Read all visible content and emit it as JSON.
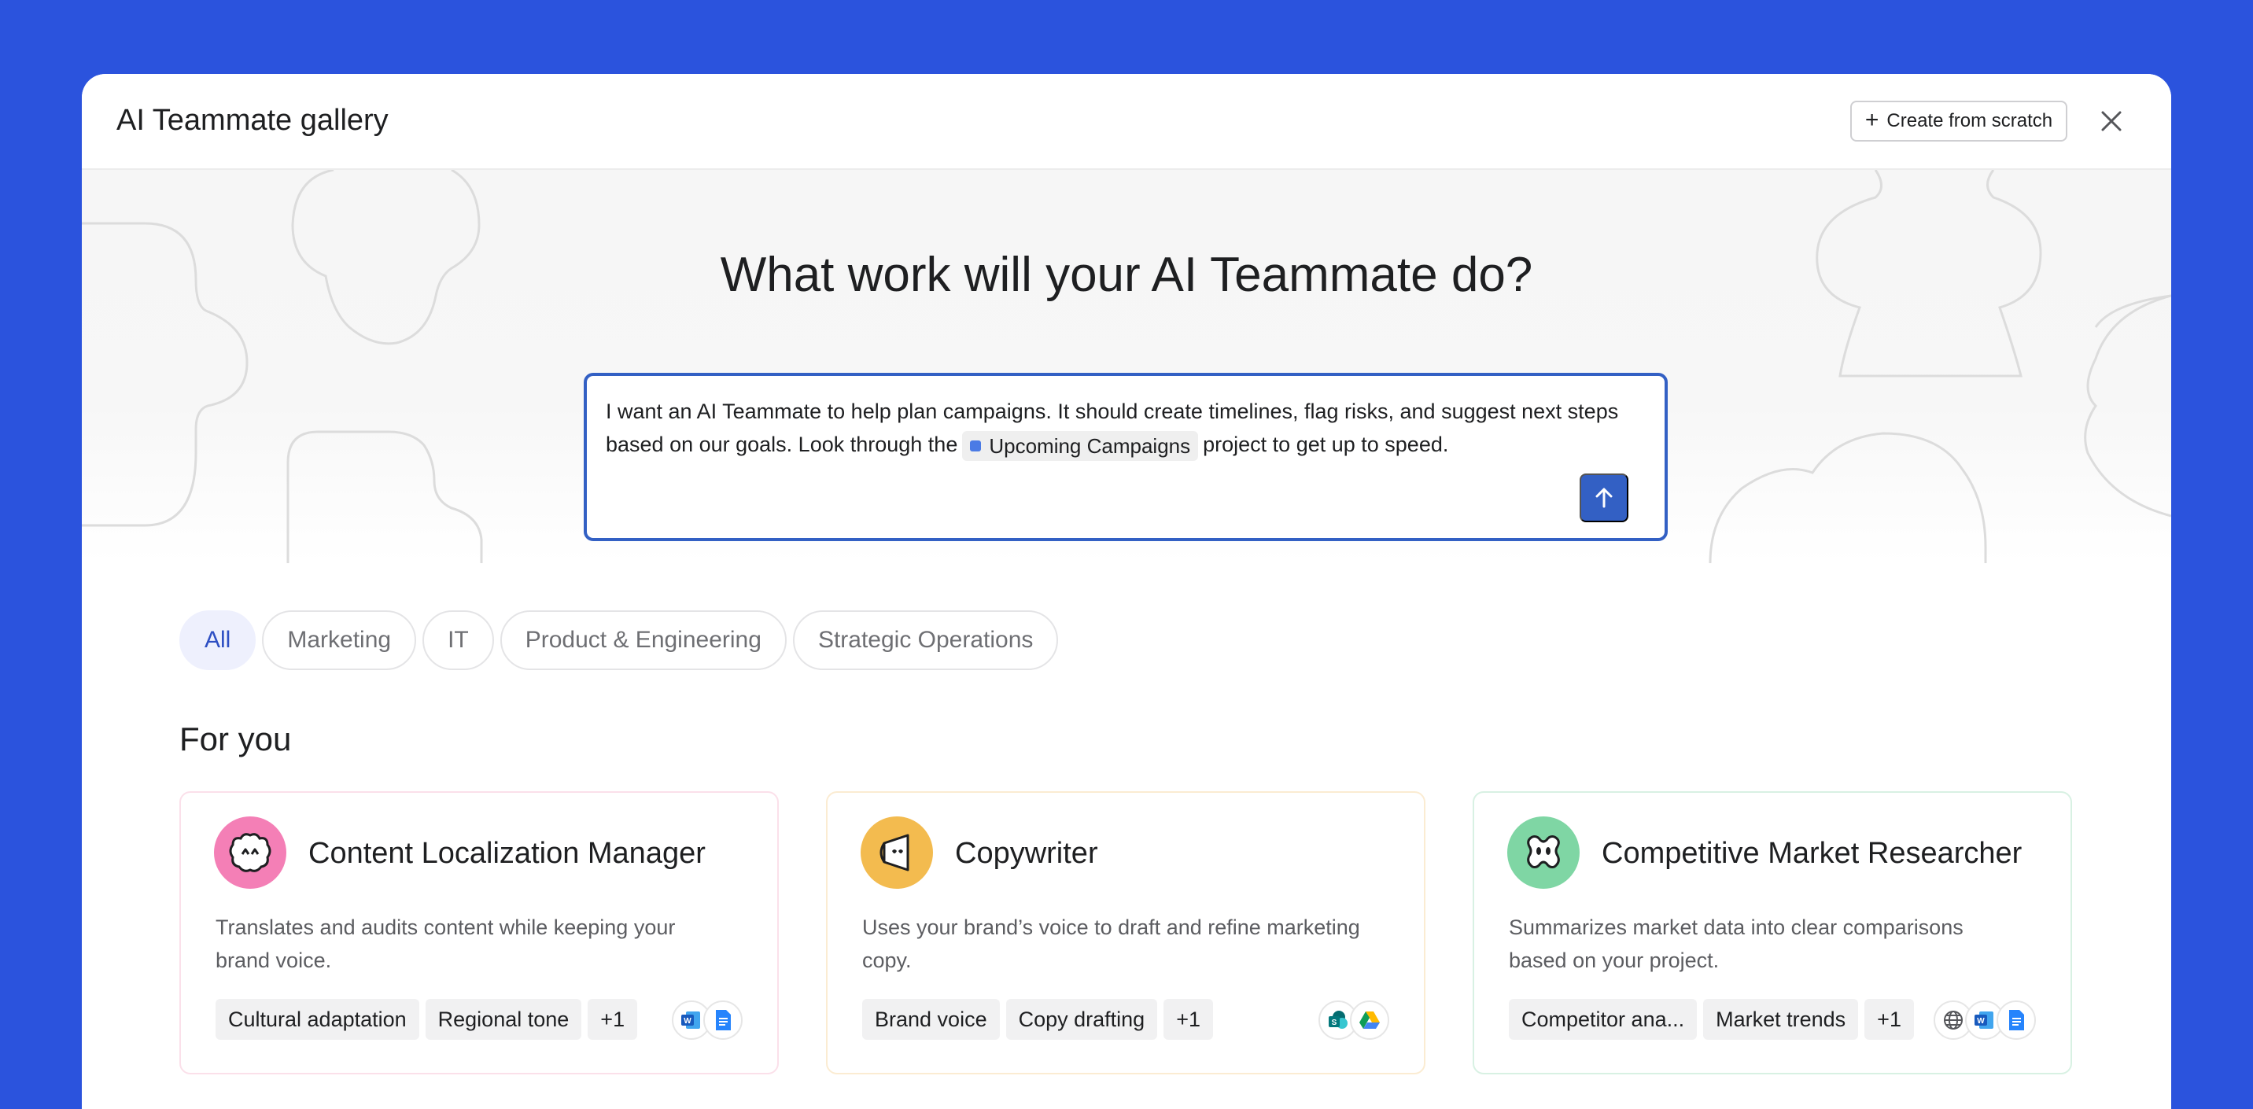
{
  "modal": {
    "title": "AI Teammate gallery",
    "create_button": "Create from scratch",
    "close_icon": "close-icon"
  },
  "hero": {
    "title": "What work will your AI Teammate do?",
    "prompt": {
      "text_before": "I want an AI Teammate to help plan campaigns. It should create timelines, flag risks, and suggest next steps based on our goals. Look through the",
      "chip": "Upcoming Campaigns",
      "text_after": "project to get up to speed.",
      "send_icon": "arrow-up-icon"
    }
  },
  "filters": {
    "items": [
      {
        "label": "All",
        "active": true
      },
      {
        "label": "Marketing",
        "active": false
      },
      {
        "label": "IT",
        "active": false
      },
      {
        "label": "Product & Engineering",
        "active": false
      },
      {
        "label": "Strategic Operations",
        "active": false
      }
    ]
  },
  "section": {
    "title": "For you"
  },
  "cards": [
    {
      "title": "Content Localization Manager",
      "description": "Translates and audits content while keeping your brand voice.",
      "tags": [
        "Cultural adaptation",
        "Regional tone",
        "+1"
      ],
      "apps": [
        "word-icon",
        "docs-icon"
      ],
      "avatar_color": "#f47fb6"
    },
    {
      "title": "Copywriter",
      "description": "Uses your brand’s voice to draft and refine marketing copy.",
      "tags": [
        "Brand voice",
        "Copy drafting",
        "+1"
      ],
      "apps": [
        "sharepoint-icon",
        "google-drive-icon"
      ],
      "avatar_color": "#f3bb4f"
    },
    {
      "title": "Competitive Market Researcher",
      "description": "Summarizes market data into clear comparisons based on your project.",
      "tags": [
        "Competitor ana...",
        "Market trends",
        "+1"
      ],
      "apps": [
        "globe-icon",
        "word-icon",
        "docs-icon"
      ],
      "avatar_color": "#7fd6a4"
    }
  ],
  "colors": {
    "background": "#2b53dd",
    "accent": "#3360c4"
  }
}
